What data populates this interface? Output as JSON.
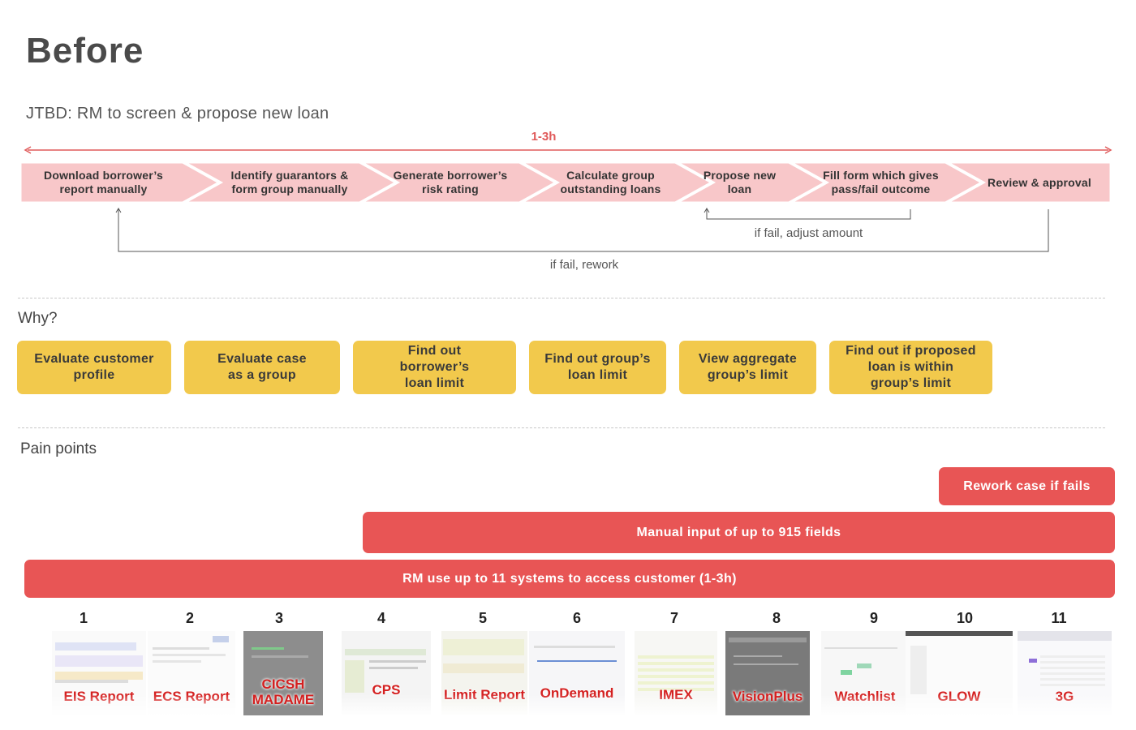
{
  "title": "Before",
  "jtbd": "JTBD: RM to screen & propose new loan",
  "duration": "1-3h",
  "steps": [
    "Download borrower’s report manually",
    "Identify guarantors & form group manually",
    "Generate borrower’s risk rating",
    "Calculate group outstanding loans",
    "Propose new loan",
    "Fill form which gives pass/fail outcome",
    "Review & approval"
  ],
  "loops": {
    "adjust": "if fail, adjust amount",
    "rework": "if fail, rework"
  },
  "why": {
    "heading": "Why?",
    "items": [
      "Evaluate customer profile",
      "Evaluate case as a group",
      "Find out borrower’s loan limit",
      "Find out group’s loan limit",
      "View aggregate group’s limit",
      "Find out if proposed loan is within group’s limit"
    ]
  },
  "pain": {
    "heading": "Pain points",
    "bars": [
      "Rework case if fails",
      "Manual input of up to 915 fields",
      "RM use up to 11 systems to access customer (1-3h)"
    ]
  },
  "systems": [
    {
      "num": "1",
      "name": "EIS Report"
    },
    {
      "num": "2",
      "name": "ECS Report"
    },
    {
      "num": "3",
      "name": "CICSH MADAME"
    },
    {
      "num": "4",
      "name": "CPS"
    },
    {
      "num": "5",
      "name": "Limit Report"
    },
    {
      "num": "6",
      "name": "OnDemand"
    },
    {
      "num": "7",
      "name": "IMEX"
    },
    {
      "num": "8",
      "name": "VisionPlus"
    },
    {
      "num": "9",
      "name": "Watchlist"
    },
    {
      "num": "10",
      "name": "GLOW"
    },
    {
      "num": "11",
      "name": "3G"
    }
  ],
  "colors": {
    "step_fill": "#f8c7c9",
    "accent_red": "#e85555",
    "why_yellow": "#f2c94c"
  }
}
